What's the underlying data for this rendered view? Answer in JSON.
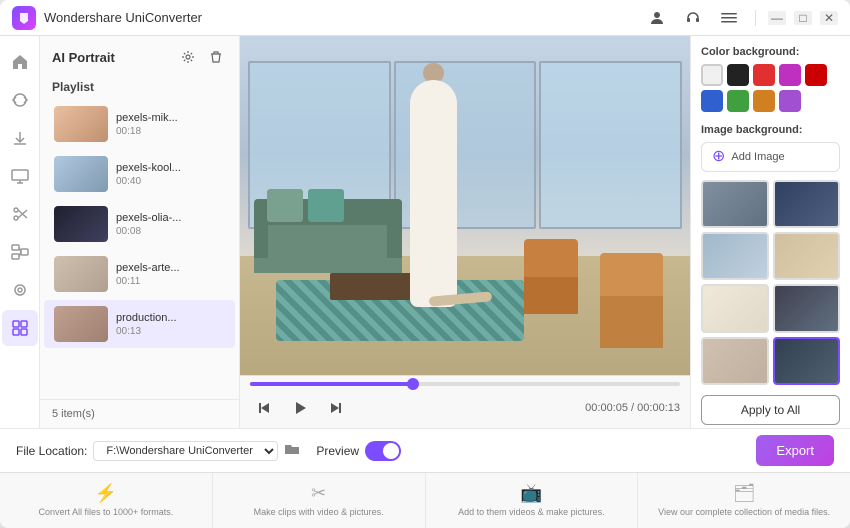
{
  "titleBar": {
    "title": "Wondershare UniConverter",
    "logoAlt": "UniConverter Logo",
    "icons": [
      "user-icon",
      "headphone-icon",
      "menu-icon"
    ],
    "windowControls": [
      "minimize",
      "maximize",
      "close"
    ]
  },
  "aiPanel": {
    "title": "AI Portrait",
    "playlistLabel": "Playlist",
    "items": [
      {
        "name": "pexels-mik...",
        "duration": "00:18",
        "thumbClass": "thumb-1"
      },
      {
        "name": "pexels-kool...",
        "duration": "00:40",
        "thumbClass": "thumb-2"
      },
      {
        "name": "pexels-olia-...",
        "duration": "00:08",
        "thumbClass": "thumb-3"
      },
      {
        "name": "pexels-arte...",
        "duration": "00:11",
        "thumbClass": "thumb-4"
      },
      {
        "name": "production...",
        "duration": "00:13",
        "thumbClass": "thumb-5"
      }
    ],
    "footer": "5 item(s)"
  },
  "rightPanel": {
    "colorBgLabel": "Color background:",
    "colors": [
      "#f0f0f0",
      "#222222",
      "#e03030",
      "#c030c0",
      "#cc0000",
      "#3060d0",
      "#40a040",
      "#d08020",
      "#a050d0"
    ],
    "imageBgLabel": "Image background:",
    "addImageLabel": "Add Image",
    "applyAllLabel": "Apply to All",
    "imageThumbs": [
      {
        "class": "img-bg-1"
      },
      {
        "class": "img-bg-2"
      },
      {
        "class": "img-bg-3"
      },
      {
        "class": "img-bg-4"
      },
      {
        "class": "img-bg-5"
      },
      {
        "class": "img-bg-6"
      },
      {
        "class": "img-bg-7"
      },
      {
        "class": "img-bg-8"
      }
    ]
  },
  "videoControls": {
    "currentTime": "00:00:05",
    "totalTime": "00:00:13",
    "progressPercent": 38
  },
  "bottomBar": {
    "fileLocationLabel": "File Location:",
    "locationValue": "F:\\Wondershare UniConverter",
    "previewLabel": "Preview",
    "exportLabel": "Export"
  },
  "bottomNav": [
    {
      "icon": "⚡",
      "text": "Convert All files\nto 1000+ formats."
    },
    {
      "icon": "✂",
      "text": "Make clips with\nvideo & pictures."
    },
    {
      "icon": "📺",
      "text": "Add to them videos &\nmake pictures."
    },
    {
      "icon": "🗂",
      "text": "View our complete\ncollection of media files."
    }
  ],
  "sidebarIcons": [
    {
      "name": "home-icon",
      "symbol": "⌂"
    },
    {
      "name": "convert-icon",
      "symbol": "↻"
    },
    {
      "name": "download-icon",
      "symbol": "↓"
    },
    {
      "name": "screen-icon",
      "symbol": "▣"
    },
    {
      "name": "scissors-icon",
      "symbol": "✂"
    },
    {
      "name": "merge-icon",
      "symbol": "⊞"
    },
    {
      "name": "toolbox-icon",
      "symbol": "⊙"
    },
    {
      "name": "grid-icon",
      "symbol": "⊟",
      "active": true
    }
  ]
}
